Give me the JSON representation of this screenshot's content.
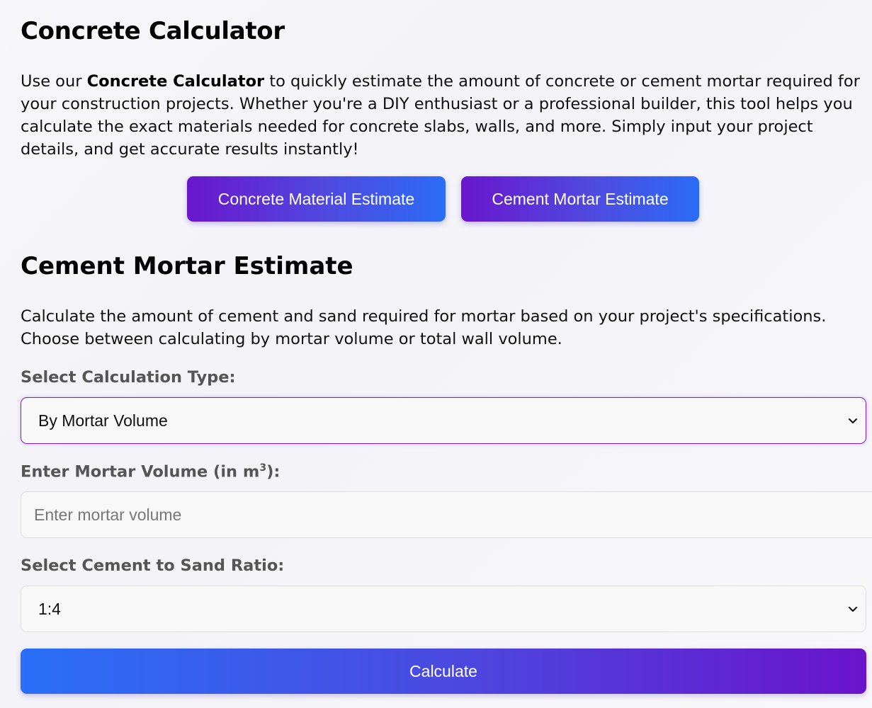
{
  "header": {
    "title": "Concrete Calculator"
  },
  "intro": {
    "before": "Use our ",
    "bold": "Concrete Calculator",
    "after": " to quickly estimate the amount of concrete or cement mortar required for your construction projects. Whether you're a DIY enthusiast or a professional builder, this tool helps you calculate the exact materials needed for concrete slabs, walls, and more. Simply input your project details, and get accurate results instantly!"
  },
  "tabs": [
    {
      "label": "Concrete Material Estimate"
    },
    {
      "label": "Cement Mortar Estimate"
    }
  ],
  "section": {
    "title": "Cement Mortar Estimate",
    "description": "Calculate the amount of cement and sand required for mortar based on your project's specifications. Choose between calculating by mortar volume or total wall volume."
  },
  "form": {
    "calc_type": {
      "label": "Select Calculation Type:",
      "value": "By Mortar Volume"
    },
    "mortar_volume": {
      "label_prefix": "Enter Mortar Volume (in m",
      "label_sup": "3",
      "label_suffix": "):",
      "placeholder": "Enter mortar volume",
      "value": ""
    },
    "ratio": {
      "label": "Select Cement to Sand Ratio:",
      "value": "1:4"
    },
    "calculate_label": "Calculate"
  },
  "colors": {
    "accent_purple": "#6a16cd",
    "accent_blue": "#2b6cf6",
    "focus_border": "#7a1fc9"
  },
  "icons": {
    "dropdown": "chevron-down-icon"
  }
}
